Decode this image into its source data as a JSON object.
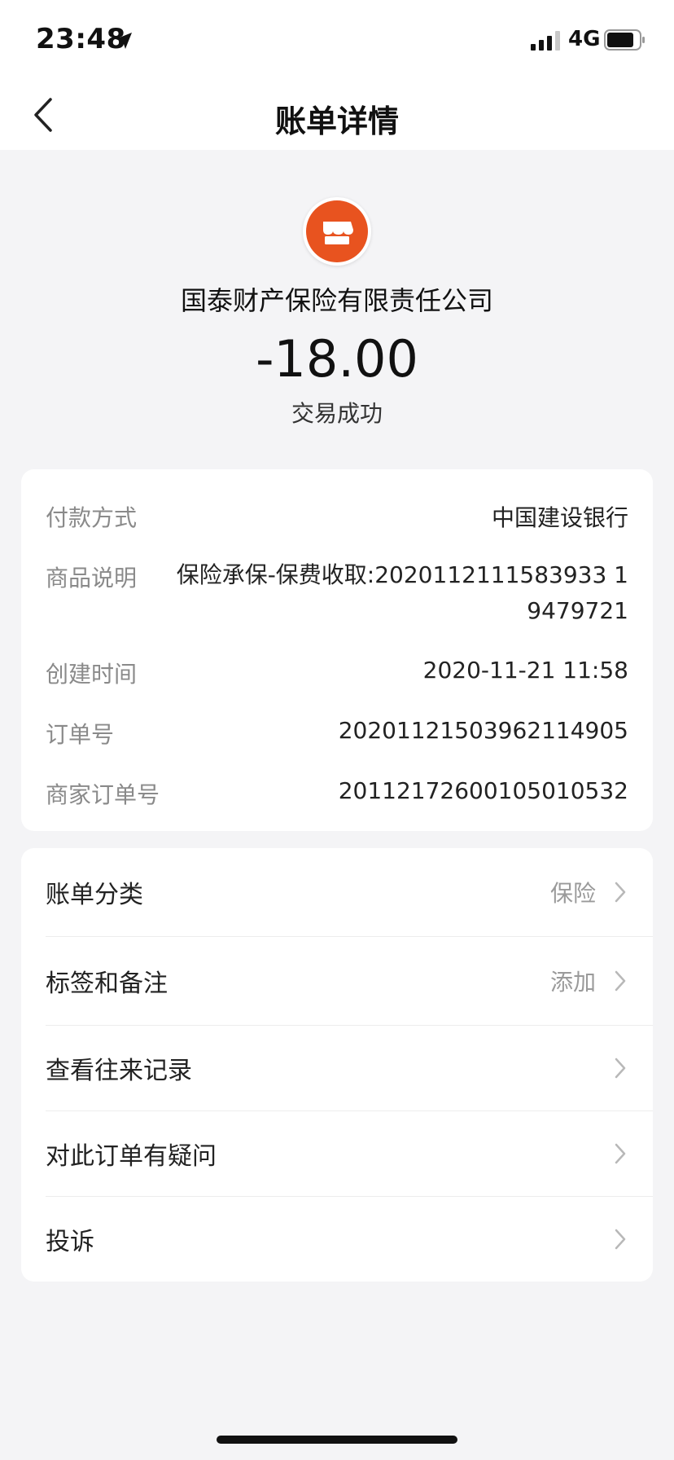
{
  "status_bar": {
    "time": "23:48",
    "network": "4G",
    "location_icon": "location-arrow-icon",
    "signal_icon": "signal-bars-icon",
    "battery_icon": "battery-icon"
  },
  "nav": {
    "title": "账单详情",
    "back_icon": "chevron-left-icon"
  },
  "merchant": {
    "name": "国泰财产保险有限责任公司",
    "logo_icon": "store-icon",
    "logo_color": "#E8531F",
    "amount": "-18.00",
    "status": "交易成功"
  },
  "details": [
    {
      "label": "付款方式",
      "value": "中国建设银行"
    },
    {
      "label": "商品说明",
      "value": "保险承保-保费收取:2020112111583933 19479721"
    },
    {
      "label": "创建时间",
      "value": "2020-11-21 11:58"
    },
    {
      "label": "订单号",
      "value": "20201121503962114905"
    },
    {
      "label": "商家订单号",
      "value": "20112172600105010532"
    }
  ],
  "actions": [
    {
      "label": "账单分类",
      "value": "保险"
    },
    {
      "label": "标签和备注",
      "value": "添加"
    },
    {
      "label": "查看往来记录",
      "value": ""
    },
    {
      "label": "对此订单有疑问",
      "value": ""
    },
    {
      "label": "投诉",
      "value": ""
    }
  ],
  "colors": {
    "background": "#F4F4F6",
    "card": "#FFFFFF",
    "label_gray": "#8A8A8A",
    "brand_orange": "#E8531F"
  }
}
